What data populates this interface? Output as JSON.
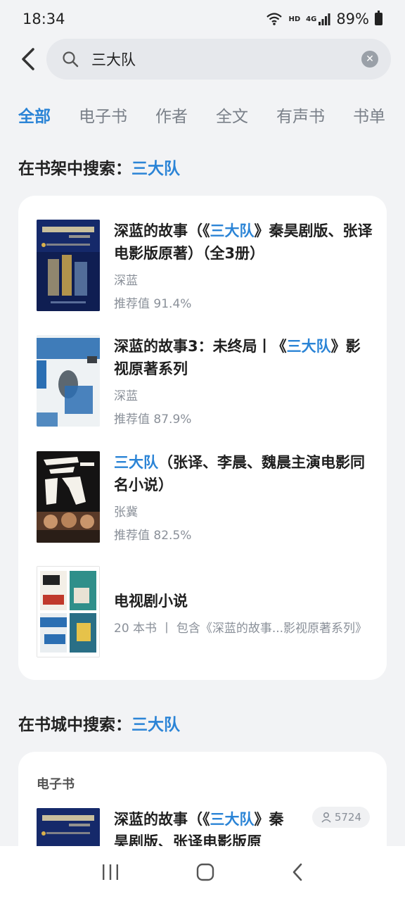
{
  "status": {
    "time": "18:34",
    "hd": "HD",
    "net": "4G",
    "battery": "89%"
  },
  "search": {
    "query": "三大队"
  },
  "tabs": [
    {
      "label": "全部",
      "active": true
    },
    {
      "label": "电子书"
    },
    {
      "label": "作者"
    },
    {
      "label": "全文"
    },
    {
      "label": "有声书"
    },
    {
      "label": "书单"
    }
  ],
  "shelf": {
    "title_prefix": "在书架中搜索：",
    "keyword": "三大队",
    "books": [
      {
        "title_pre": "深蓝的故事（《",
        "title_kw": "三大队",
        "title_post": "》秦昊剧版、张译电影版原著）（全3册）",
        "author": "深蓝",
        "score": "推荐值 91.4%"
      },
      {
        "title_pre": "深蓝的故事3：未终局丨《",
        "title_kw": "三大队",
        "title_post": "》影视原著系列",
        "author": "深蓝",
        "score": "推荐值 87.9%"
      },
      {
        "title_pre": "",
        "title_kw": "三大队",
        "title_post": "（张译、李晨、魏晨主演电影同名小说）",
        "author": "张冀",
        "score": "推荐值 82.5%"
      }
    ],
    "list": {
      "title": "电视剧小说",
      "meta": "20 本书 丨 包含《深蓝的故事...影视原著系列》"
    }
  },
  "store": {
    "title_prefix": "在书城中搜索：",
    "keyword": "三大队",
    "sub_label": "电子书",
    "book": {
      "title_pre": "深蓝的故事（《",
      "title_kw": "三大队",
      "title_post": "》秦昊剧版、张译电影版原著...",
      "readers": "5724"
    }
  },
  "colors": {
    "accent": "#2b84d6",
    "background": "#f2f3f5"
  }
}
